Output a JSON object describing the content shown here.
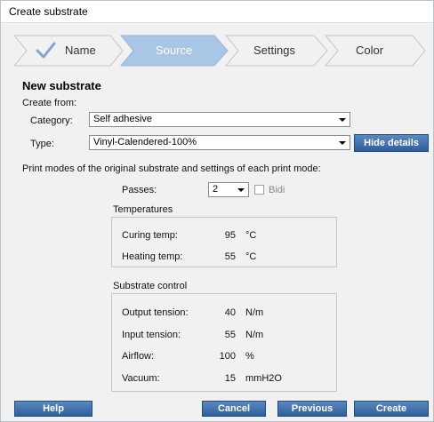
{
  "window": {
    "title": "Create substrate"
  },
  "wizard": {
    "steps": [
      {
        "label": "Name",
        "state": "done"
      },
      {
        "label": "Source",
        "state": "active"
      },
      {
        "label": "Settings",
        "state": "pending"
      },
      {
        "label": "Color",
        "state": "pending"
      }
    ],
    "active_color": "#a8c6e6",
    "done_check_color": "#7fa6d0"
  },
  "form": {
    "section_title": "New substrate",
    "create_from_label": "Create from:",
    "category_label": "Category:",
    "category_value": "Self adhesive",
    "type_label": "Type:",
    "type_value": "Vinyl-Calendered-100%",
    "hide_details_label": "Hide details",
    "print_modes_text": "Print modes of the original substrate and settings of each print mode:",
    "passes_label": "Passes:",
    "passes_value": "2",
    "bidi_label": "Bidi",
    "bidi_checked": false
  },
  "temperatures": {
    "title": "Temperatures",
    "rows": [
      {
        "label": "Curing temp:",
        "value": "95",
        "unit": "°C"
      },
      {
        "label": "Heating temp:",
        "value": "55",
        "unit": "°C"
      }
    ]
  },
  "substrate_control": {
    "title": "Substrate control",
    "rows": [
      {
        "label": "Output tension:",
        "value": "40",
        "unit": "N/m"
      },
      {
        "label": "Input tension:",
        "value": "55",
        "unit": "N/m"
      },
      {
        "label": "Airflow:",
        "value": "100",
        "unit": "%"
      },
      {
        "label": "Vacuum:",
        "value": "15",
        "unit": "mmH2O"
      }
    ]
  },
  "buttons": {
    "help": "Help",
    "cancel": "Cancel",
    "previous": "Previous",
    "create": "Create"
  },
  "colors": {
    "button_blue": "#3a6aa8",
    "window_bg": "#f1f1f1"
  }
}
